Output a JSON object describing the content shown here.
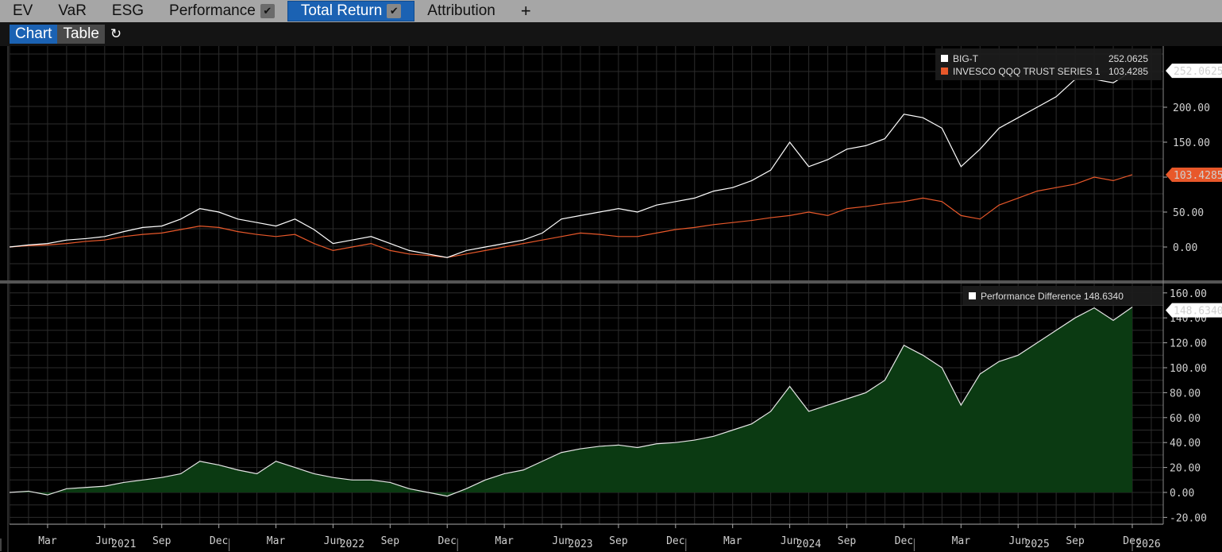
{
  "tabs": [
    {
      "label": "EV"
    },
    {
      "label": "VaR"
    },
    {
      "label": "ESG"
    },
    {
      "label": "Performance",
      "checked": true
    },
    {
      "label": "Total Return",
      "checked": true,
      "active": true
    },
    {
      "label": "Attribution"
    }
  ],
  "add_tab": "+",
  "view": {
    "chart": "Chart",
    "table": "Table",
    "refresh_icon": "refresh-icon"
  },
  "colors": {
    "bigt": "#ffffff",
    "qqq": "#e8582a",
    "diff_fill": "#0b3a12",
    "diff_line": "#e6e6e6"
  },
  "chart_data": [
    {
      "type": "line",
      "title": "Total Return",
      "ylim": [
        -25,
        265
      ],
      "yticks": [
        "0.00",
        "50.00",
        "100.00",
        "150.00",
        "200.00"
      ],
      "ytick_values": [
        0,
        50,
        100,
        150,
        200
      ],
      "legend_placement": "top-right",
      "series": [
        {
          "name": "BIG-T",
          "last": "252.0625",
          "values": [
            0,
            3,
            5,
            10,
            12,
            15,
            22,
            28,
            30,
            40,
            55,
            50,
            40,
            35,
            30,
            40,
            25,
            5,
            10,
            15,
            5,
            -5,
            -10,
            -15,
            -5,
            0,
            5,
            10,
            20,
            40,
            45,
            50,
            55,
            50,
            60,
            65,
            70,
            80,
            85,
            95,
            110,
            150,
            115,
            125,
            140,
            145,
            155,
            190,
            185,
            170,
            115,
            140,
            170,
            185,
            200,
            215,
            240,
            240,
            235,
            252.06
          ]
        },
        {
          "name": "INVESCO QQQ TRUST SERIES 1",
          "last": "103.4285",
          "values": [
            0,
            2,
            3,
            5,
            8,
            10,
            15,
            18,
            20,
            25,
            30,
            28,
            22,
            18,
            15,
            18,
            5,
            -5,
            0,
            5,
            -5,
            -10,
            -12,
            -15,
            -10,
            -5,
            0,
            5,
            10,
            15,
            20,
            18,
            15,
            15,
            20,
            25,
            28,
            32,
            35,
            38,
            42,
            45,
            50,
            45,
            55,
            58,
            62,
            65,
            70,
            65,
            45,
            40,
            60,
            70,
            80,
            85,
            90,
            100,
            95,
            103.43
          ]
        }
      ]
    },
    {
      "type": "area",
      "ylim": [
        -22,
        162
      ],
      "yticks": [
        "-20.00",
        "0.00",
        "20.00",
        "40.00",
        "60.00",
        "80.00",
        "100.00",
        "120.00",
        "140.00",
        "160.00"
      ],
      "ytick_values": [
        -20,
        0,
        20,
        40,
        60,
        80,
        100,
        120,
        140,
        160
      ],
      "legend_placement": "top-right",
      "series": [
        {
          "name": "Performance Difference",
          "last": "148.6340",
          "values": [
            0,
            1,
            -2,
            3,
            4,
            5,
            8,
            10,
            12,
            15,
            25,
            22,
            18,
            15,
            25,
            20,
            15,
            12,
            10,
            10,
            8,
            3,
            0,
            -3,
            3,
            10,
            15,
            18,
            25,
            32,
            35,
            37,
            38,
            36,
            39,
            40,
            42,
            45,
            50,
            55,
            65,
            85,
            65,
            70,
            75,
            80,
            90,
            118,
            110,
            100,
            70,
            95,
            105,
            110,
            120,
            130,
            140,
            148,
            138,
            148.63
          ]
        }
      ]
    }
  ],
  "x_axis": {
    "start": "Jan 2021",
    "months": [
      "Mar",
      "Jun",
      "Sep",
      "Dec"
    ],
    "years": [
      "2021",
      "2022",
      "2023",
      "2024",
      "2025",
      "2026"
    ]
  }
}
